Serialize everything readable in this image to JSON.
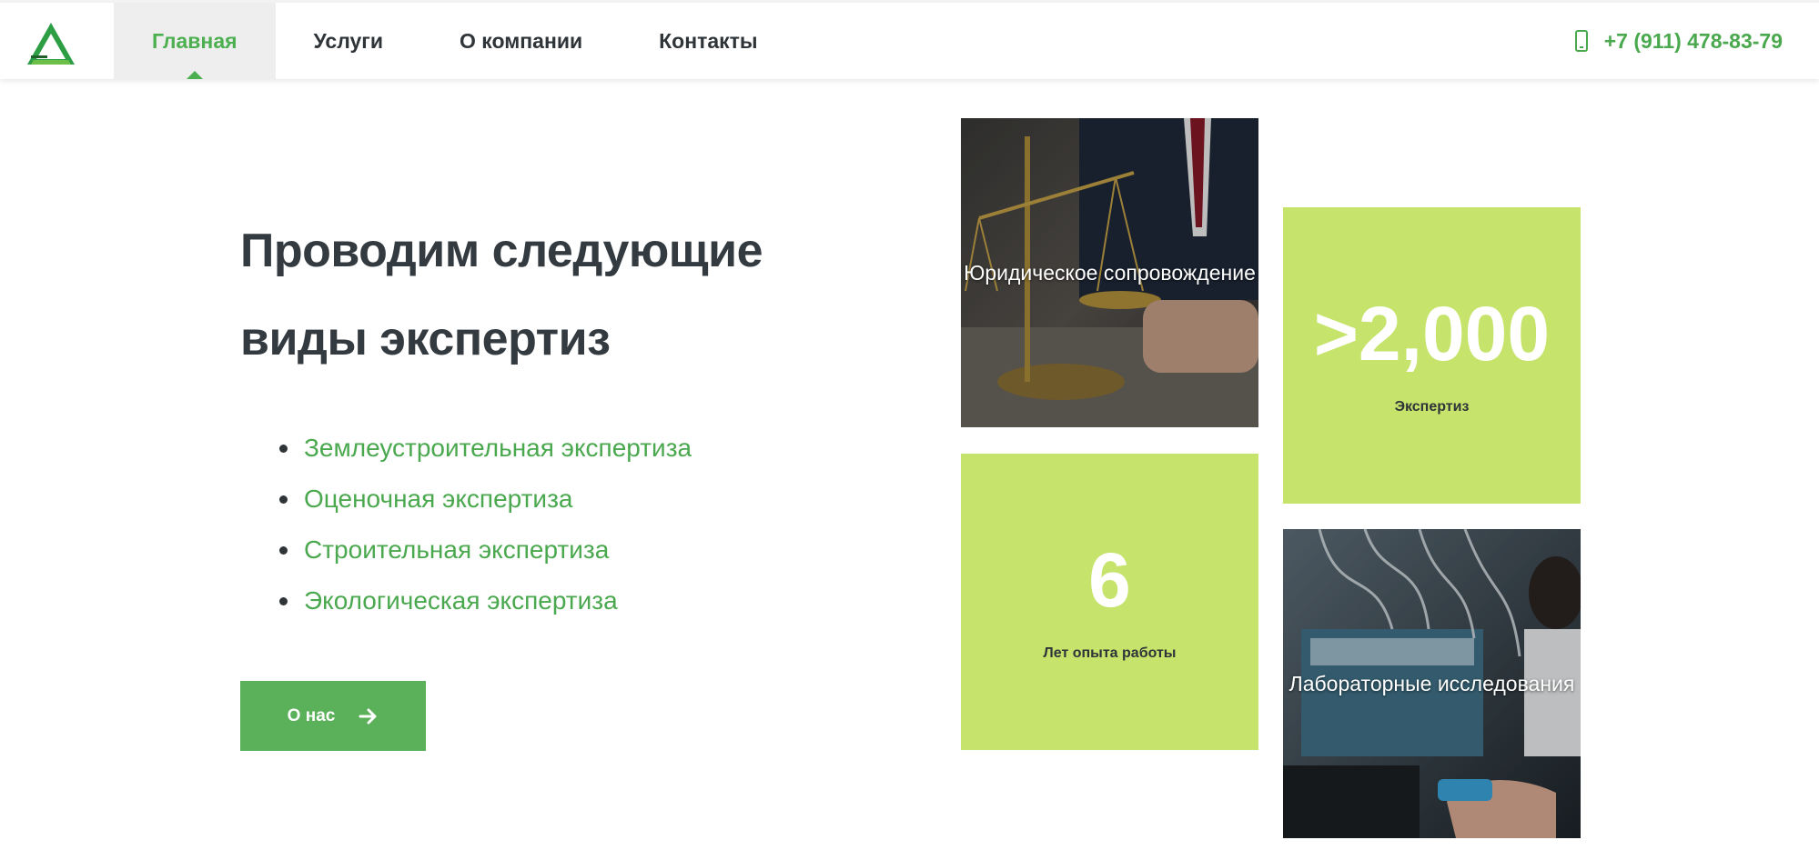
{
  "header": {
    "logo_icon": "triangle-logo-icon",
    "nav": [
      {
        "label": "Главная",
        "active": true
      },
      {
        "label": "Услуги",
        "active": false
      },
      {
        "label": "О компании",
        "active": false
      },
      {
        "label": "Контакты",
        "active": false
      }
    ],
    "phone_icon": "smartphone-icon",
    "phone": "+7 (911) 478-83-79"
  },
  "hero": {
    "headline": "Проводим следующие виды экспертиз",
    "services": [
      "Землеустроительная экспертиза",
      "Оценочная экспертиза",
      "Строительная экспертиза",
      "Экологическая экспертиза"
    ],
    "button_label": "О нас",
    "button_icon": "arrow-right-icon"
  },
  "tiles": {
    "legal": {
      "caption": "Юридическое сопровождение",
      "image": "scales-of-justice-photo"
    },
    "expertises": {
      "value": ">2,000",
      "label": "Экспертиз"
    },
    "experience": {
      "value": "6",
      "label": "Лет опыта работы"
    },
    "lab": {
      "caption": "Лабораторные исследования",
      "image": "laboratory-equipment-photo"
    }
  },
  "colors": {
    "accent_green": "#4caf50",
    "button_green": "#5bb05a",
    "tile_lime": "#c6e36b",
    "heading": "#333a40"
  }
}
